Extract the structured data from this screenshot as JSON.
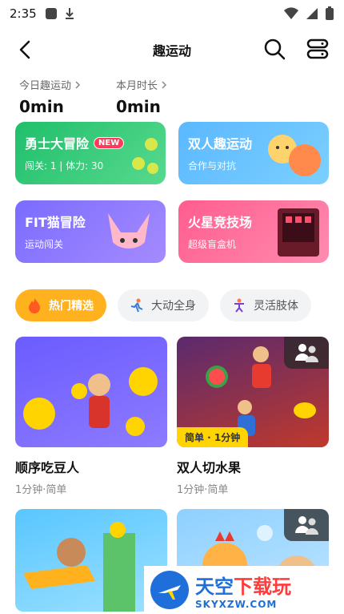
{
  "status_bar": {
    "time": "2:35"
  },
  "header": {
    "title": "趣运动"
  },
  "stats": [
    {
      "label": "今日趣运动",
      "value": "0min"
    },
    {
      "label": "本月时长",
      "value": "0min"
    }
  ],
  "feature_cards": [
    {
      "title": "勇士大冒险",
      "badge": "NEW",
      "subtitle": "闯关: 1 | 体力: 30"
    },
    {
      "title": "双人趣运动",
      "subtitle": "合作与对抗"
    },
    {
      "title": "FIT猫冒险",
      "subtitle": "运动闯关"
    },
    {
      "title": "火星竞技场",
      "subtitle": "超级盲盒机"
    }
  ],
  "tabs": [
    {
      "label": "热门精选",
      "active": true
    },
    {
      "label": "大动全身",
      "active": false
    },
    {
      "label": "灵活肢体",
      "active": false
    }
  ],
  "games": [
    {
      "name": "顺序吃豆人",
      "meta": "1分钟·简单"
    },
    {
      "name": "双人切水果",
      "meta": "1分钟·简单",
      "tag": "简单 · 1分钟"
    },
    {
      "name": "",
      "meta": ""
    },
    {
      "name": "",
      "meta": ""
    }
  ],
  "watermark": {
    "line1_a": "天空",
    "line1_b": "下载玩",
    "line2": "SKYXZW.COM"
  }
}
